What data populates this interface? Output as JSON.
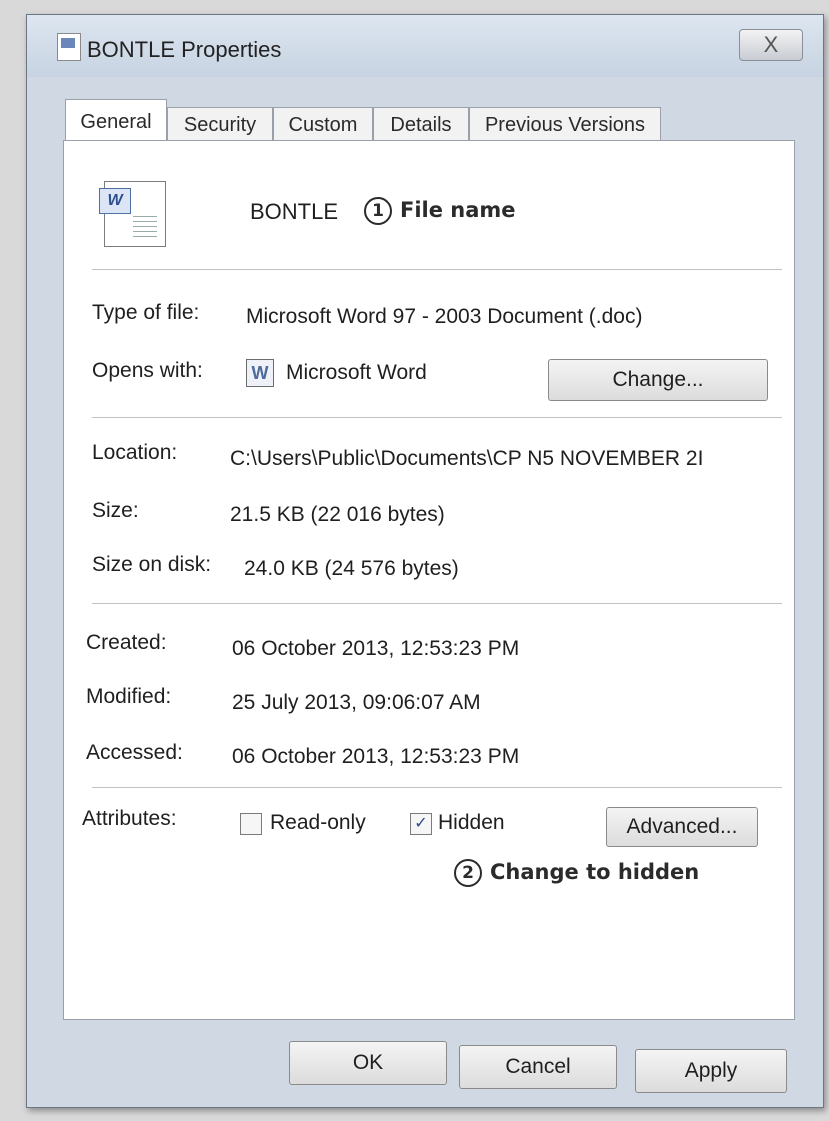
{
  "window": {
    "title": "BONTLE Properties",
    "close_glyph": "X"
  },
  "tabs": [
    {
      "label": "General",
      "active": true
    },
    {
      "label": "Security"
    },
    {
      "label": "Custom"
    },
    {
      "label": "Details"
    },
    {
      "label": "Previous Versions"
    }
  ],
  "file": {
    "name": "BONTLE",
    "callout_number": "1",
    "callout_text": "File name",
    "icon": "word-document-icon"
  },
  "type": {
    "label": "Type of file:",
    "value": "Microsoft Word 97 - 2003 Document (.doc)"
  },
  "opens": {
    "label": "Opens with:",
    "value": "Microsoft Word",
    "icon_glyph": "W",
    "change_button": "Change..."
  },
  "location": {
    "label": "Location:",
    "value": "C:\\Users\\Public\\Documents\\CP N5 NOVEMBER 2I"
  },
  "size": {
    "label": "Size:",
    "value": "21.5 KB (22 016 bytes)"
  },
  "size_on_disk": {
    "label": "Size on disk:",
    "value": "24.0 KB (24 576 bytes)"
  },
  "created": {
    "label": "Created:",
    "value": "06 October 2013, 12:53:23 PM"
  },
  "modified": {
    "label": "Modified:",
    "value": "25 July 2013, 09:06:07 AM"
  },
  "accessed": {
    "label": "Accessed:",
    "value": "06 October 2013, 12:53:23 PM"
  },
  "attributes": {
    "label": "Attributes:",
    "readonly": {
      "label": "Read-only",
      "checked": false
    },
    "hidden": {
      "label": "Hidden",
      "checked": true,
      "check_glyph": "✓"
    },
    "advanced_button": "Advanced...",
    "callout_number": "2",
    "callout_text": "Change to hidden"
  },
  "buttons": {
    "ok": "OK",
    "cancel": "Cancel",
    "apply": "Apply"
  }
}
